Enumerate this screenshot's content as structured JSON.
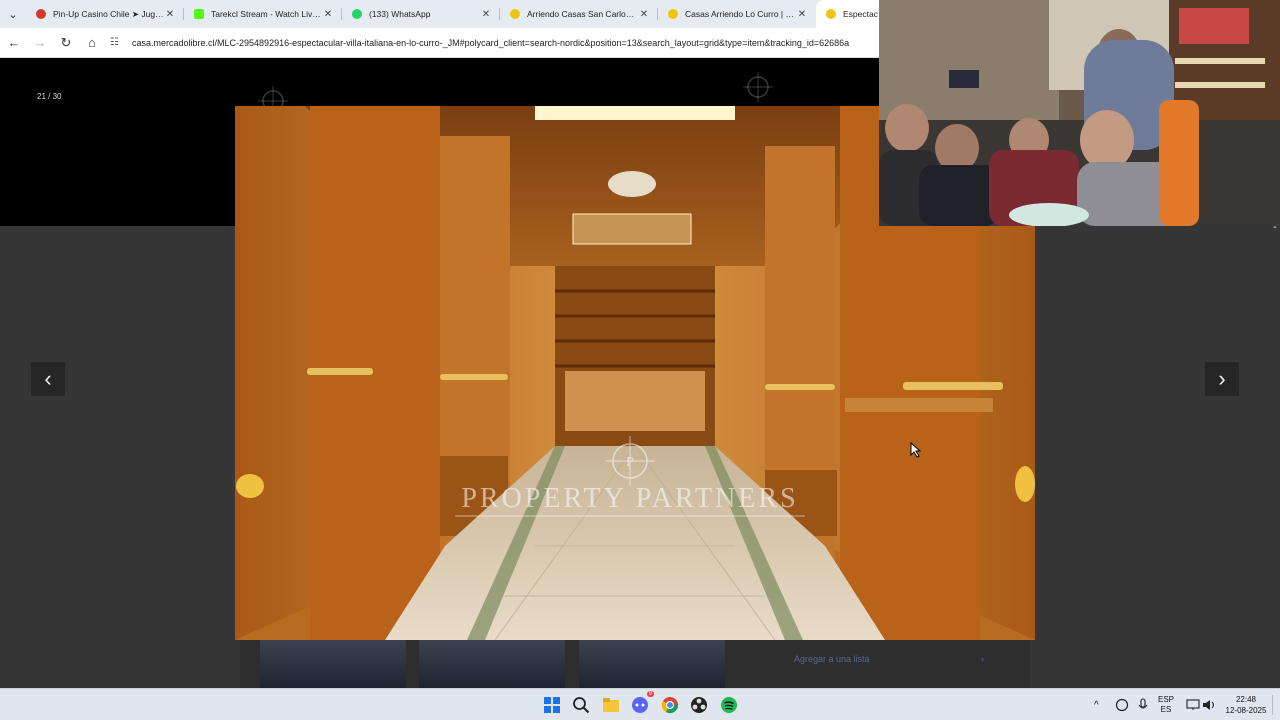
{
  "browser": {
    "tabs": [
      {
        "title": "Pin-Up Casino Chile ➤ Jugar al",
        "favicon_color": "#d6382e",
        "active": false
      },
      {
        "title": "Tarekcl Stream - Watch Live on",
        "favicon_color": "#53fc18",
        "active": false
      },
      {
        "title": "(133) WhatsApp",
        "favicon_color": "#25d366",
        "active": false
      },
      {
        "title": "Arriendo Casas San Carlos | Me",
        "favicon_color": "#f1c40f",
        "active": false
      },
      {
        "title": "Casas Arriendo Lo Curro | Merc",
        "favicon_color": "#f1c40f",
        "active": false
      },
      {
        "title": "Espectacular",
        "favicon_color": "#f1c40f",
        "active": true
      }
    ],
    "close_glyph": "✕",
    "menu_glyph": "⌄",
    "nav": {
      "back": "←",
      "forward": "→",
      "reload": "↻",
      "home": "⌂",
      "tune": "☷"
    },
    "url": "casa.mercadolibre.cl/MLC-2954892916-espectacular-villa-italiana-en-lo-curro-_JM#polycard_client=search-nordic&position=13&search_layout=grid&type=item&tracking_id=62686a"
  },
  "viewer": {
    "counter": "21 / 30",
    "prev_glyph": "‹",
    "next_glyph": "›",
    "watermark": "PROPERTY PARTNERS",
    "watermark_logo": "P",
    "behind_link": "Agregar a una lista",
    "behind_link_chevron": "›"
  },
  "taskbar": {
    "icons": [
      "windows-start",
      "search",
      "file-explorer",
      "discord",
      "chrome",
      "obs",
      "spotify"
    ],
    "tray_chevron": "^",
    "lang_top": "ESP",
    "lang_bottom": "ES",
    "time": "22:48",
    "date": "12-08-2025",
    "discord_badge": "9"
  },
  "colors": {
    "tabbar": "#e6ebf1",
    "page_bg": "#363636",
    "taskbar": "#dfe6ee",
    "wood": "#b86c22"
  }
}
